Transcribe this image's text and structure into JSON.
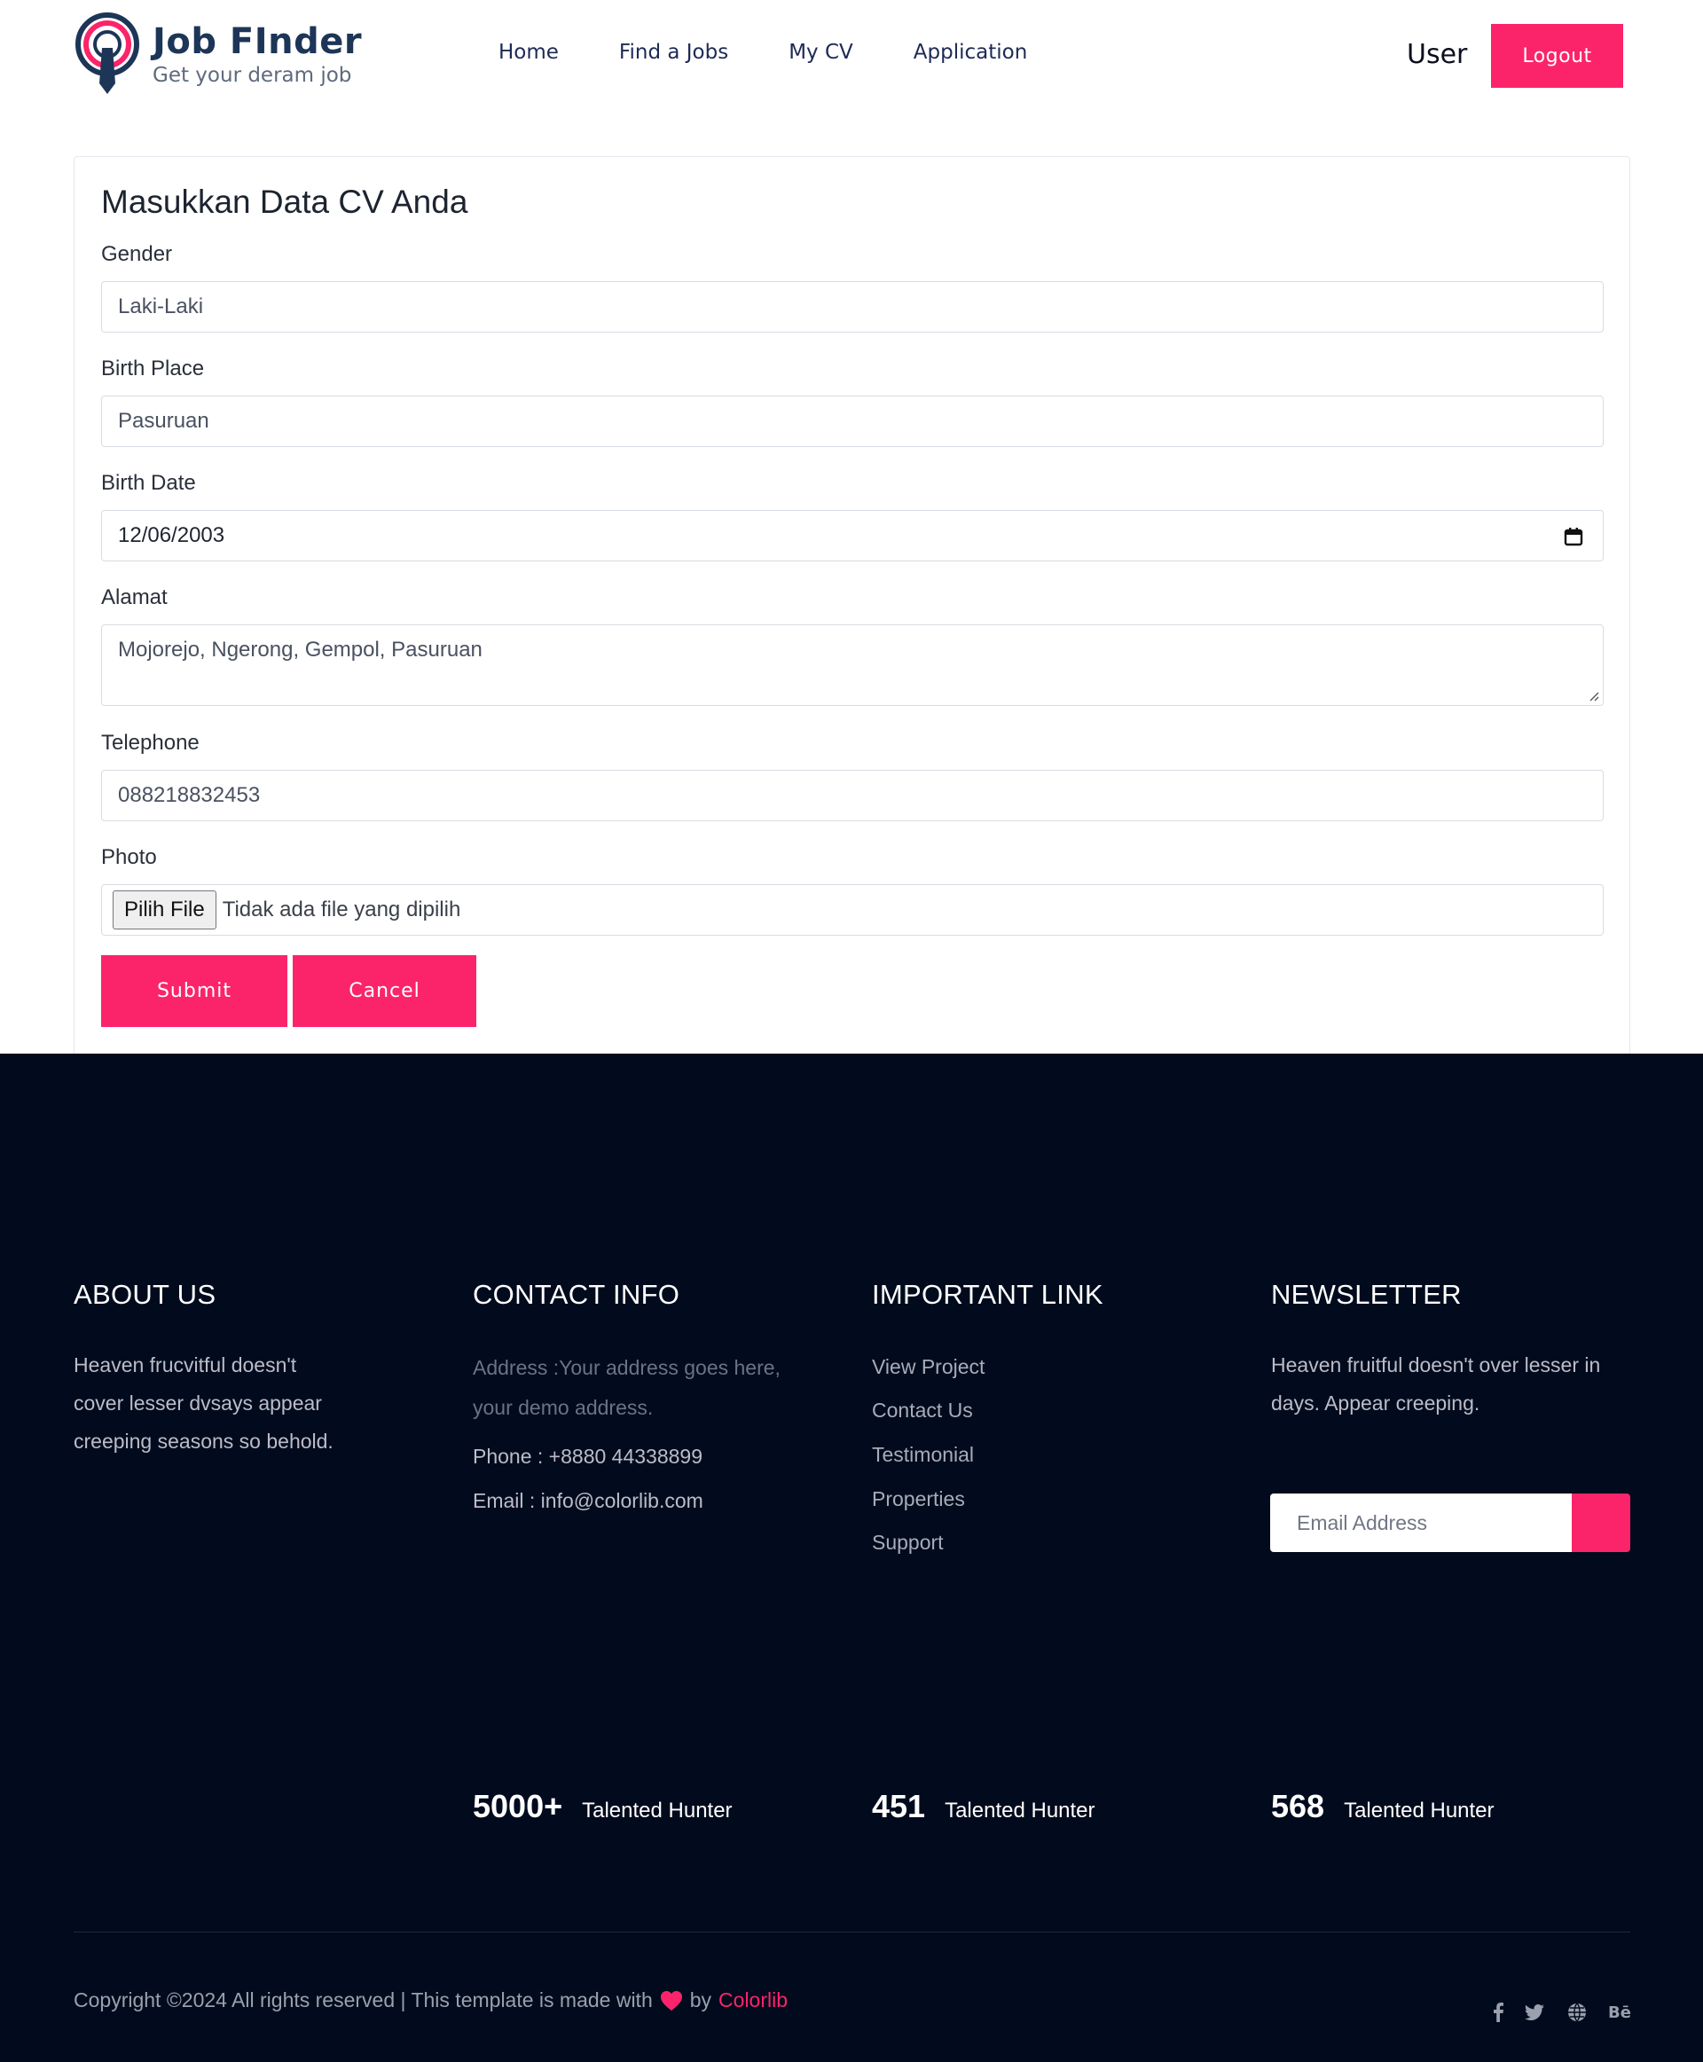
{
  "header": {
    "logo": {
      "title": "Job FInder",
      "subtitle": "Get your deram job"
    },
    "nav": [
      "Home",
      "Find a Jobs",
      "My CV",
      "Application"
    ],
    "user_label": "User",
    "logout_label": "Logout"
  },
  "form": {
    "title": "Masukkan Data CV Anda",
    "fields": {
      "gender": {
        "label": "Gender",
        "value": "Laki-Laki"
      },
      "birth_place": {
        "label": "Birth Place",
        "value": "Pasuruan"
      },
      "birth_date": {
        "label": "Birth Date",
        "value": "12/06/2003"
      },
      "alamat": {
        "label": "Alamat",
        "value": "Mojorejo, Ngerong, Gempol, Pasuruan"
      },
      "telephone": {
        "label": "Telephone",
        "value": "088218832453"
      },
      "photo": {
        "label": "Photo",
        "button": "Pilih File",
        "status": "Tidak ada file yang dipilih"
      }
    },
    "submit_label": "Submit",
    "cancel_label": "Cancel"
  },
  "footer": {
    "about": {
      "title": "ABOUT US",
      "lines": [
        "Heaven frucvitful doesn't",
        "cover lesser dvsays appear",
        "creeping seasons so behold."
      ]
    },
    "contact": {
      "title": "CONTACT INFO",
      "address_lines": [
        "Address :Your address goes here,",
        "your demo address."
      ],
      "phone": "Phone : +8880 44338899",
      "email": "Email : info@colorlib.com"
    },
    "links": {
      "title": "IMPORTANT LINK",
      "items": [
        "View Project",
        "Contact Us",
        "Testimonial",
        "Properties",
        "Support"
      ]
    },
    "newsletter": {
      "title": "NEWSLETTER",
      "lines": [
        "Heaven fruitful doesn't over lesser in",
        "days. Appear creeping."
      ],
      "placeholder": "Email Address"
    },
    "stats": [
      {
        "num": "5000+",
        "label": "Talented Hunter"
      },
      {
        "num": "451",
        "label": "Talented Hunter"
      },
      {
        "num": "568",
        "label": "Talented Hunter"
      }
    ],
    "copyright": {
      "before": "Copyright ©2024 All rights reserved | This template is made with",
      "by": "by",
      "link": "Colorlib"
    },
    "social": [
      "facebook-icon",
      "twitter-icon",
      "globe-icon",
      "behance-icon"
    ]
  },
  "colors": {
    "accent": "#fb246a",
    "footer_bg": "#010b1d",
    "brand_navy": "#1d3557"
  }
}
